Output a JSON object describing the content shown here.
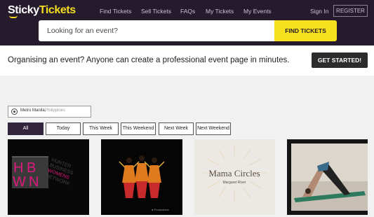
{
  "header": {
    "logo_part1": "Sticky",
    "logo_part2": "Tickets",
    "nav": [
      "Find Tickets",
      "Sell Tickets",
      "FAQs",
      "My Tickets",
      "My Events"
    ],
    "signin": "Sign In",
    "register": "REGISTER"
  },
  "search": {
    "placeholder": "Looking for an event?",
    "button": "FIND TICKETS"
  },
  "promo": {
    "text": "Organising an event? Anyone can create a professional event page in minutes.",
    "button": "GET STARTED!"
  },
  "location": {
    "city": "Metro Manila,",
    "country": "Philippines"
  },
  "filters": {
    "items": [
      "All",
      "Today",
      "This Week",
      "This Weekend",
      "Next Week",
      "Next Weekend"
    ],
    "active": "All"
  },
  "cards": {
    "card1": {
      "logo_letters": [
        "H",
        "B",
        "W",
        "N"
      ],
      "logo_text": [
        "HUNTER",
        "BUSINESS",
        "WOMENS",
        "NETWORK"
      ]
    },
    "card2": {
      "caption": "● Productions"
    },
    "card3": {
      "title": "Mama Circles",
      "subtitle": "Margaret River"
    }
  },
  "colors": {
    "header_bg": "#251b2d",
    "brand_yellow": "#f5dd1d",
    "hbwn_pink": "#e0197d",
    "active_filter": "#33253d"
  },
  "icons": [
    "location-pin-icon"
  ]
}
